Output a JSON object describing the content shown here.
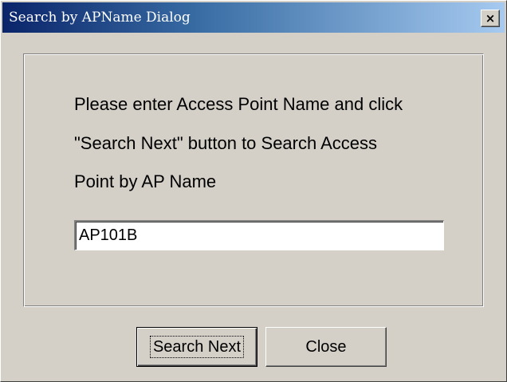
{
  "window": {
    "title": "Search by APName Dialog",
    "close_symbol": "×"
  },
  "instructions": [
    "Please enter Access Point Name and click",
    "\"Search Next\" button to Search Access",
    "Point by AP Name"
  ],
  "ap_name_input": {
    "value": "AP101B"
  },
  "buttons": {
    "search_next": "Search Next",
    "close": "Close"
  },
  "colors": {
    "title_gradient_start": "#0a246a",
    "title_gradient_end": "#a6caf0",
    "face": "#d4d0c8"
  }
}
